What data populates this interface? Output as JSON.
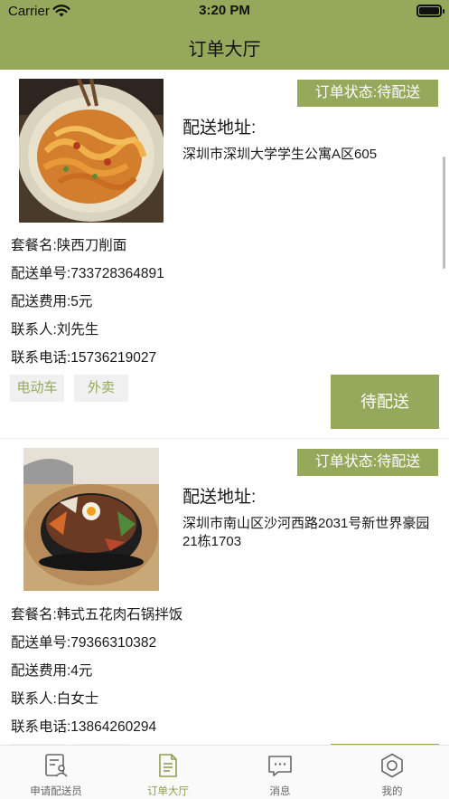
{
  "status_bar": {
    "carrier": "Carrier",
    "time": "3:20 PM"
  },
  "header": {
    "title": "订单大厅"
  },
  "orders": [
    {
      "status": "订单状态:待配送",
      "address_title": "配送地址:",
      "address": "深圳市深圳大学学生公寓A区605",
      "package": "套餐名:陕西刀削面",
      "order_no": "配送单号:733728364891",
      "fee": "配送费用:5元",
      "contact": "联系人:刘先生",
      "phone": "联系电话:15736219027",
      "tags": [
        "电动车",
        "外卖"
      ],
      "action": "待配送"
    },
    {
      "status": "订单状态:待配送",
      "address_title": "配送地址:",
      "address": "深圳市南山区沙河西路2031号新世界豪园21栋1703",
      "package": "套餐名:韩式五花肉石锅拌饭",
      "order_no": "配送单号:79366310382",
      "fee": "配送费用:4元",
      "contact": "联系人:白女士",
      "phone": "联系电话:13864260294"
    }
  ],
  "tabbar": {
    "items": [
      {
        "label": "申请配送员",
        "icon": "apply-courier-icon"
      },
      {
        "label": "订单大厅",
        "icon": "order-hall-icon",
        "active": true
      },
      {
        "label": "消息",
        "icon": "message-icon"
      },
      {
        "label": "我的",
        "icon": "profile-icon"
      }
    ]
  },
  "colors": {
    "accent": "#96a85c",
    "tag_bg": "#f0f0f0",
    "tab_active": "#8e9f52"
  }
}
